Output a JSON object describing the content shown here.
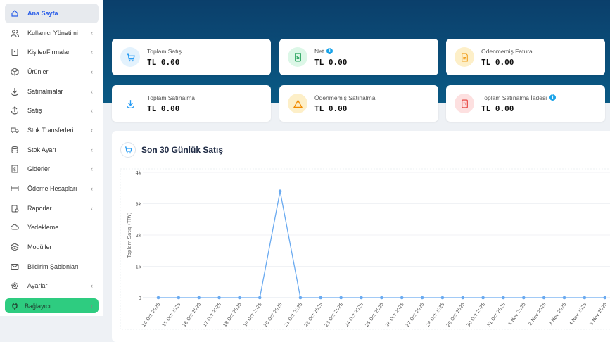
{
  "sidebar": {
    "items": [
      {
        "label": "Ana Sayfa",
        "icon": "home-icon",
        "chevron": false,
        "active": true
      },
      {
        "label": "Kullanıcı Yönetimi",
        "icon": "users-icon",
        "chevron": true
      },
      {
        "label": "Kişiler/Firmalar",
        "icon": "contacts-icon",
        "chevron": true
      },
      {
        "label": "Ürünler",
        "icon": "box-icon",
        "chevron": true
      },
      {
        "label": "Satınalmalar",
        "icon": "download-icon",
        "chevron": true
      },
      {
        "label": "Satış",
        "icon": "upload-icon",
        "chevron": true
      },
      {
        "label": "Stok Transferleri",
        "icon": "truck-icon",
        "chevron": true
      },
      {
        "label": "Stok Ayarı",
        "icon": "database-icon",
        "chevron": true
      },
      {
        "label": "Giderler",
        "icon": "receipt-icon",
        "chevron": true
      },
      {
        "label": "Ödeme Hesapları",
        "icon": "card-icon",
        "chevron": true
      },
      {
        "label": "Raporlar",
        "icon": "report-icon",
        "chevron": true
      },
      {
        "label": "Yedekleme",
        "icon": "cloud-icon",
        "chevron": false
      },
      {
        "label": "Modüller",
        "icon": "layers-icon",
        "chevron": false
      },
      {
        "label": "Bildirim Şablonları",
        "icon": "mail-icon",
        "chevron": false
      },
      {
        "label": "Ayarlar",
        "icon": "gear-icon",
        "chevron": true
      },
      {
        "label": "Bağlayıcı",
        "icon": "plug-icon",
        "chevron": true,
        "green": true
      }
    ]
  },
  "cards": [
    {
      "title": "Toplam Satış",
      "value": "TL 0.00",
      "icon": "cart-icon",
      "bg": "#e3f2fd",
      "fg": "#2a9df4",
      "info": false
    },
    {
      "title": "Net",
      "value": "TL 0.00",
      "icon": "dollar-icon",
      "bg": "#dcf7e7",
      "fg": "#1e9e55",
      "info": true
    },
    {
      "title": "Ödenmemiş Fatura",
      "value": "TL 0.00",
      "icon": "invoice-icon",
      "bg": "#fdefc8",
      "fg": "#f0a020",
      "info": false
    },
    {
      "title": "Toplam Satınalma",
      "value": "TL 0.00",
      "icon": "download-icon",
      "bg": "#ffffff",
      "fg": "#2a9df4",
      "info": false
    },
    {
      "title": "Ödenmemiş Satınalma",
      "value": "TL 0.00",
      "icon": "warning-icon",
      "bg": "#fdefc8",
      "fg": "#f08a00",
      "info": true,
      "info_hidden": true
    },
    {
      "title": "Toplam Satınalma İadesi",
      "value": "TL 0.00",
      "icon": "return-icon",
      "bg": "#fde0e0",
      "fg": "#e53935",
      "info": true
    }
  ],
  "chart_title": "Son 30 Günlük Satış",
  "chart_data": {
    "type": "line",
    "ylabel": "Toplam Satış (TRY)",
    "ylim": [
      0,
      4000
    ],
    "yticks": [
      "0",
      "1k",
      "2k",
      "3k",
      "4k"
    ],
    "ytick_values": [
      0,
      1000,
      2000,
      3000,
      4000
    ],
    "grid": true,
    "color": "#6aaaf0",
    "x": [
      "14 Oct 2025",
      "15 Oct 2025",
      "16 Oct 2025",
      "17 Oct 2025",
      "18 Oct 2025",
      "19 Oct 2025",
      "20 Oct 2025",
      "21 Oct 2025",
      "22 Oct 2025",
      "23 Oct 2025",
      "24 Oct 2025",
      "25 Oct 2025",
      "26 Oct 2025",
      "27 Oct 2025",
      "28 Oct 2025",
      "29 Oct 2025",
      "30 Oct 2025",
      "31 Oct 2025",
      "1 Nov 2025",
      "2 Nov 2025",
      "3 Nov 2025",
      "4 Nov 2025",
      "5 Nov 2025"
    ],
    "values": [
      0,
      0,
      0,
      0,
      0,
      0,
      3400,
      0,
      0,
      0,
      0,
      0,
      0,
      0,
      0,
      0,
      0,
      0,
      0,
      0,
      0,
      0,
      0
    ]
  }
}
